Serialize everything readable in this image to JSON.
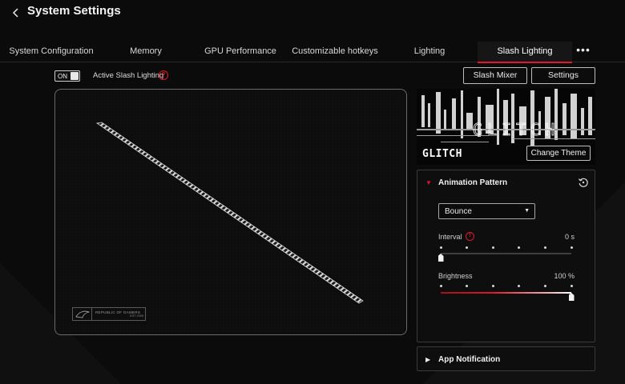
{
  "header": {
    "title": "System Settings"
  },
  "tabs": [
    {
      "label": "System Configuration"
    },
    {
      "label": "Memory"
    },
    {
      "label": "GPU Performance"
    },
    {
      "label": "Customizable hotkeys"
    },
    {
      "label": "Lighting"
    },
    {
      "label": "Slash Lighting",
      "active": true
    }
  ],
  "more_label": "•••",
  "toggle": {
    "state": "ON",
    "label": "Active Slash Lighting"
  },
  "buttons": {
    "slash_mixer": "Slash Mixer",
    "settings": "Settings"
  },
  "theme": {
    "name": "GLITCH",
    "change_label": "Change Theme"
  },
  "animation": {
    "title": "Animation Pattern",
    "pattern": "Bounce",
    "interval": {
      "label": "Interval",
      "value_text": "0 s",
      "level": 0.0,
      "steps": 6
    },
    "brightness": {
      "label": "Brightness",
      "value_text": "100 %",
      "level": 1.0,
      "steps": 6
    }
  },
  "app_notification": {
    "title": "App Notification"
  },
  "rog_badge": {
    "text": "REPUBLIC OF GAMERS",
    "est": "EST 2006"
  },
  "colors": {
    "accent": "#e0162b",
    "background": "#0b0b0b"
  },
  "icons": {
    "back": "back-chevron-icon",
    "help": "help-icon",
    "reset": "reset-icon",
    "info": "info-icon"
  }
}
